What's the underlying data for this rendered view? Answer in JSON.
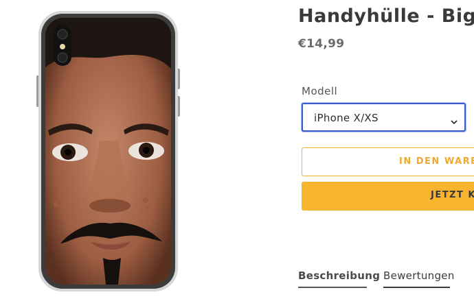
{
  "product": {
    "title": "Handyhülle - Big",
    "price": "€14,99",
    "image_alt": "phone-case-photo"
  },
  "options": {
    "model_label": "Modell",
    "model_value": "iPhone X/XS"
  },
  "buttons": {
    "add_to_cart": "IN DEN WAREN",
    "buy_now": "JETZT K"
  },
  "tabs": [
    {
      "label": "Beschreibung"
    },
    {
      "label": "Bewertungen"
    }
  ],
  "colors": {
    "accent": "#f7b42f",
    "select_border": "#3a5ccc",
    "text": "#3a3a3a"
  }
}
